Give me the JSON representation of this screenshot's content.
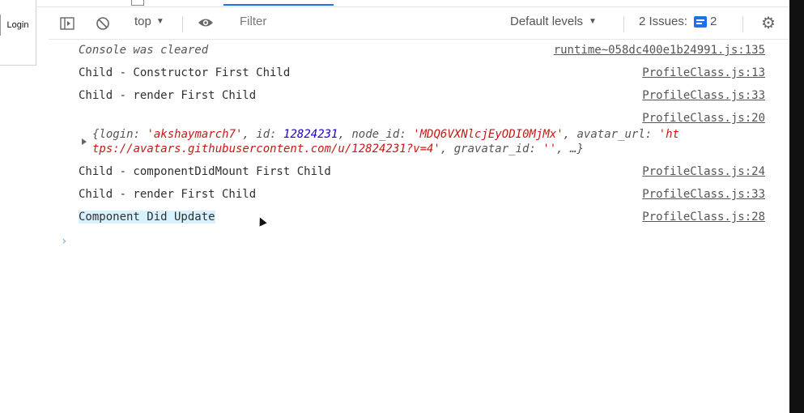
{
  "left_panel": {
    "login_label": "Login"
  },
  "toolbar": {
    "context_label": "top",
    "context_arrow": "▼",
    "filter_placeholder": "Filter",
    "levels_label": "Default levels",
    "levels_arrow": "▼",
    "issues_label": "2 Issues:",
    "issues_count": "2"
  },
  "messages": [
    {
      "text": "Console was cleared",
      "source": "runtime~058dc400e1b24991.js:135"
    },
    {
      "text": "Child - Constructor First Child",
      "source": "ProfileClass.js:13"
    },
    {
      "text": "Child - render First Child",
      "source": "ProfileClass.js:33"
    },
    {
      "text": "",
      "source": "ProfileClass.js:20"
    },
    {
      "text": "Child - componentDidMount First Child",
      "source": "ProfileClass.js:24"
    },
    {
      "text": "Child - render First Child",
      "source": "ProfileClass.js:33"
    },
    {
      "text": "Component Did Update",
      "source": "ProfileClass.js:28"
    }
  ],
  "object_log": {
    "open_brace": "{",
    "login_key": "login: ",
    "login_val": "'akshaymarch7'",
    "id_key": ", id: ",
    "id_val": "12824231",
    "node_key": ", node_id: ",
    "node_val": "'MDQ6VXNlcjEyODI0MjMx'",
    "avatar_key": ", avatar_url: ",
    "avatar_val_start": "'ht",
    "avatar_val_end": "tps://avatars.githubusercontent.com/u/12824231?v=4'",
    "gravatar_key": ", gravatar_id: ",
    "gravatar_val": "''",
    "tail": ", …}"
  },
  "prompt_symbol": "›",
  "icons": {
    "sidebar_toggle": "sidebar-toggle-icon",
    "clear": "clear-console-icon",
    "eye": "eye-icon",
    "issues": "issues-chat-icon",
    "settings": "gear-icon"
  },
  "colors": {
    "accent": "#1a73e8",
    "string": "#c41a16",
    "number": "#1c00cf",
    "highlight": "#d8f1ff"
  }
}
